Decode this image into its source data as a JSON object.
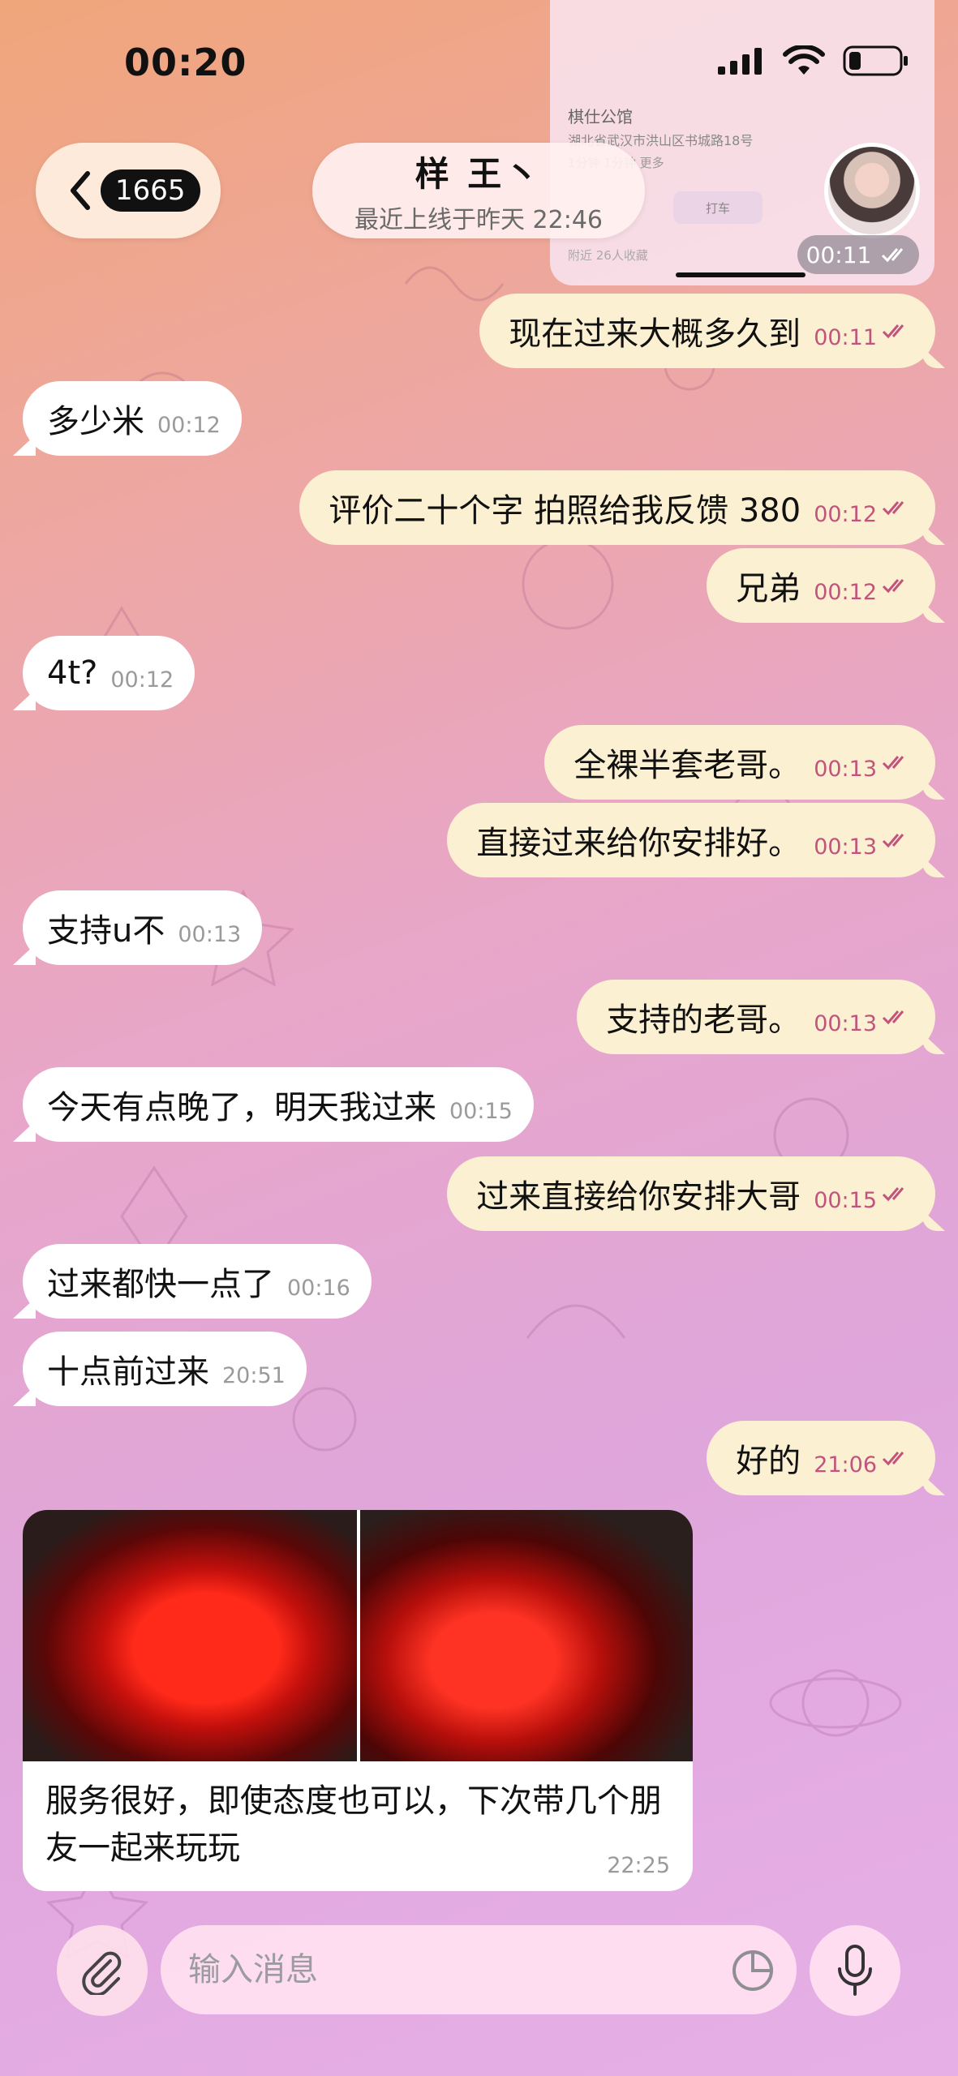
{
  "status_bar": {
    "time": "00:20"
  },
  "header": {
    "back_count": "1665",
    "contact_name": "样 王丶",
    "last_seen": "最近上线于昨天 22:46",
    "pinned_time": "00:11"
  },
  "map_card": {
    "title": "棋仕公馆",
    "address": "湖北省武汉市洪山区书城路18号",
    "row": "1分钟   1分钟   更多",
    "btn_taxi": "打车",
    "footer": "附近   26人收藏"
  },
  "messages": [
    {
      "dir": "out",
      "text": "现在过来大概多久到",
      "time": "00:11"
    },
    {
      "dir": "in",
      "text": "多少米",
      "time": "00:12"
    },
    {
      "dir": "out",
      "text": "评价二十个字 拍照给我反馈 380",
      "time": "00:12"
    },
    {
      "dir": "out",
      "text": "兄弟",
      "time": "00:12"
    },
    {
      "dir": "in",
      "text": "4t?",
      "time": "00:12"
    },
    {
      "dir": "out",
      "text": "全裸半套老哥。",
      "time": "00:13"
    },
    {
      "dir": "out",
      "text": "直接过来给你安排好。",
      "time": "00:13"
    },
    {
      "dir": "in",
      "text": "支持u不",
      "time": "00:13"
    },
    {
      "dir": "out",
      "text": "支持的老哥。",
      "time": "00:13"
    },
    {
      "dir": "in",
      "text": "今天有点晚了，明天我过来",
      "time": "00:15"
    },
    {
      "dir": "out",
      "text": "过来直接给你安排大哥",
      "time": "00:15"
    },
    {
      "dir": "in",
      "text": "过来都快一点了",
      "time": "00:16"
    },
    {
      "dir": "in",
      "text": "十点前过来",
      "time": "20:51"
    },
    {
      "dir": "out",
      "text": "好的",
      "time": "21:06"
    }
  ],
  "photo_message": {
    "caption": "服务很好，即使态度也可以，下次带几个朋友一起来玩玩",
    "time": "22:25"
  },
  "composer": {
    "placeholder": "输入消息"
  },
  "colors": {
    "outgoing_bubble": "#fbf0d2",
    "incoming_bubble": "#ffffff",
    "outgoing_time": "#c2537d"
  }
}
